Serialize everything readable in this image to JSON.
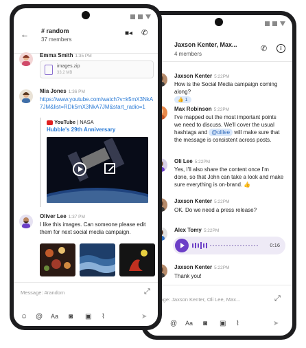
{
  "left": {
    "header": {
      "title": "# random",
      "subtitle": "37 members"
    },
    "messages": {
      "emma": {
        "name": "Emma Smith",
        "time": "1:35 PM",
        "file_name": "images.zip",
        "file_size": "33.2 MB"
      },
      "mia": {
        "name": "Mia Jones",
        "time": "1:36 PM",
        "link": "https://www.youtube.com/watch?v=k5mX3NkA7JM&list=RDk5mX3NkA7JM&start_radio=1",
        "yt_source": "YouTube",
        "yt_channel": "NASA",
        "yt_title": "Hubble's 29th Anniversary"
      },
      "oliver": {
        "name": "Oliver Lee",
        "time": "1:37 PM",
        "text": "I like this images. Can someone please edit them for next social media campaign."
      }
    },
    "composer": {
      "placeholder": "Message: #random"
    }
  },
  "right": {
    "header": {
      "title": "Jaxson Kenter, Max...",
      "subtitle": "4 members"
    },
    "messages": {
      "m1": {
        "name": "Jaxson Kenter",
        "time": "5:22PM",
        "text": "How is the Social Media campaign coming along?",
        "reaction": "👍 1"
      },
      "m2": {
        "name": "Max Robinson",
        "time": "5:22PM",
        "text_a": "I've mapped out the most important points we need to discuss. We'll cover the usual hashtags and ",
        "mention": "@olilee",
        "text_b": " will make sure that the message is consistent across posts."
      },
      "m3": {
        "name": "Oli Lee",
        "time": "5:22PM",
        "text": "Yes, I'll also share the content once I'm done, so that John can take a look and make sure everything is on-brand. 👍"
      },
      "m4": {
        "name": "Jaxson Kenter",
        "time": "5:22PM",
        "text": "OK. Do we need a press release?"
      },
      "m5": {
        "name": "Alex Tomy",
        "time": "5:22PM",
        "duration": "0:16"
      },
      "m6": {
        "name": "Jaxson Kenter",
        "time": "5:22PM",
        "text": "Thank you!"
      }
    },
    "composer": {
      "placeholder": "ssage: Jaxson Kenter, Oli Lee, Max..."
    }
  },
  "colors": {
    "accent": "#6c3fc7",
    "link": "#2b7bd6",
    "mention_bg": "#dbe9fb"
  }
}
